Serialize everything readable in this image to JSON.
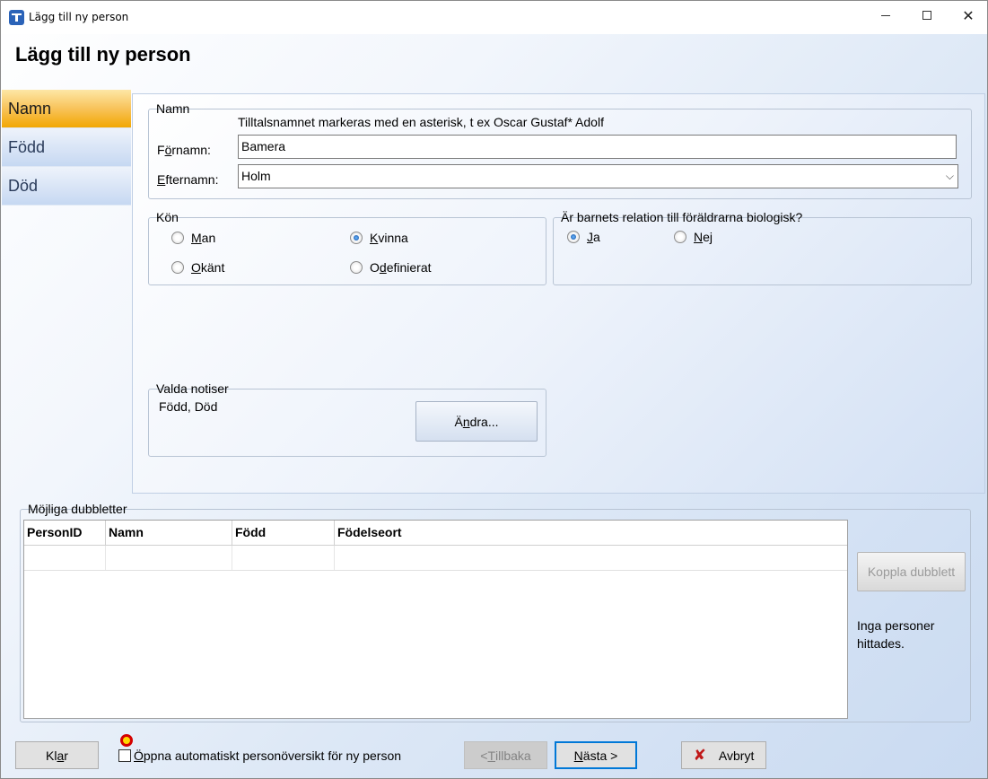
{
  "window": {
    "title": "Lägg till ny person"
  },
  "page_title": "Lägg till ny person",
  "nav": {
    "items": [
      {
        "label": "Namn",
        "active": true
      },
      {
        "label": "Född",
        "active": false
      },
      {
        "label": "Död",
        "active": false
      }
    ]
  },
  "name_group": {
    "legend": "Namn",
    "hint": "Tilltalsnamnet markeras med en asterisk, t ex  Oscar Gustaf* Adolf",
    "firstname_label_pre": "F",
    "firstname_label_ul": "ö",
    "firstname_label_post": "rnamn:",
    "firstname_value": "Bamera",
    "lastname_label_ul": "E",
    "lastname_label_post": "fternamn:",
    "lastname_value": "Holm"
  },
  "gender_group": {
    "legend": "Kön",
    "options": [
      {
        "ul": "M",
        "rest": "an",
        "selected": false
      },
      {
        "ul": "K",
        "rest": "vinna",
        "selected": true
      },
      {
        "ul": "O",
        "rest": "känt",
        "selected": false
      },
      {
        "pre": "O",
        "ul": "d",
        "rest": "efinierat",
        "selected": false
      }
    ]
  },
  "bio_group": {
    "legend": "Är barnets relation till föräldrarna biologisk?",
    "options": [
      {
        "ul": "J",
        "rest": "a",
        "selected": true
      },
      {
        "ul": "N",
        "rest": "ej",
        "selected": false
      }
    ]
  },
  "notes_group": {
    "legend": "Valda notiser",
    "value": "Född, Död",
    "change_button_pre": "Ä",
    "change_button_ul": "n",
    "change_button_post": "dra..."
  },
  "duplicates": {
    "legend": "Möjliga dubbletter",
    "columns": [
      "PersonID",
      "Namn",
      "Född",
      "Födelseort"
    ],
    "link_button": "Koppla dubblett",
    "status_line1": "Inga personer",
    "status_line2": "hittades."
  },
  "footer": {
    "done_pre": "Kl",
    "done_ul": "a",
    "done_post": "r",
    "auto_open_ul": "Ö",
    "auto_open_rest": "ppna automatiskt personöversikt för ny person",
    "auto_open_checked": false,
    "back_pre": "< ",
    "back_ul": "T",
    "back_post": "illbaka",
    "next_ul": "N",
    "next_post": "ästa >",
    "cancel_label": "Avbryt"
  },
  "icons": {
    "app": "app-icon",
    "cancel": "red-x-icon",
    "marker": "recording-indicator-icon"
  }
}
